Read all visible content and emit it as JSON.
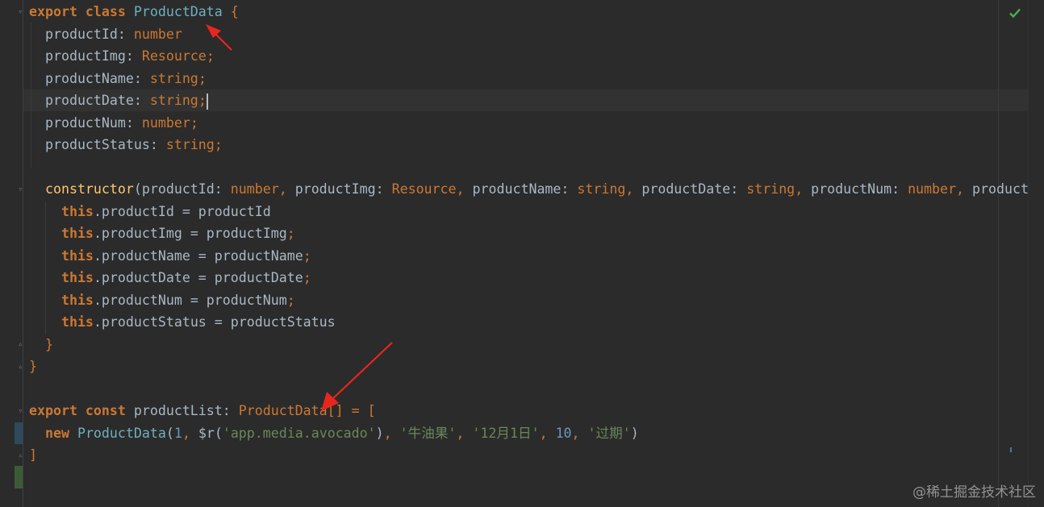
{
  "editor": {
    "code_lines": [
      {
        "tokens": [
          {
            "c": "kw",
            "t": "export class "
          },
          {
            "c": "cls",
            "t": "ProductData"
          },
          {
            "c": "fld",
            "t": " "
          },
          {
            "c": "punc",
            "t": "{"
          }
        ]
      },
      {
        "tokens": [
          {
            "c": "fld",
            "t": "  productId: "
          },
          {
            "c": "type",
            "t": "number"
          }
        ]
      },
      {
        "tokens": [
          {
            "c": "fld",
            "t": "  productImg: "
          },
          {
            "c": "type",
            "t": "Resource"
          },
          {
            "c": "punc",
            "t": ";"
          }
        ]
      },
      {
        "tokens": [
          {
            "c": "fld",
            "t": "  productName: "
          },
          {
            "c": "type",
            "t": "string"
          },
          {
            "c": "punc",
            "t": ";"
          }
        ]
      },
      {
        "tokens": [
          {
            "c": "fld",
            "t": "  productDate: "
          },
          {
            "c": "type",
            "t": "string"
          },
          {
            "c": "punc",
            "t": ";"
          }
        ],
        "cursor": true
      },
      {
        "tokens": [
          {
            "c": "fld",
            "t": "  productNum: "
          },
          {
            "c": "type",
            "t": "number"
          },
          {
            "c": "punc",
            "t": ";"
          }
        ]
      },
      {
        "tokens": [
          {
            "c": "fld",
            "t": "  productStatus: "
          },
          {
            "c": "type",
            "t": "string"
          },
          {
            "c": "punc",
            "t": ";"
          }
        ]
      },
      {
        "tokens": []
      },
      {
        "tokens": [
          {
            "c": "fn",
            "t": "  constructor"
          },
          {
            "c": "fld",
            "t": "(productId: "
          },
          {
            "c": "type",
            "t": "number"
          },
          {
            "c": "punc",
            "t": ","
          },
          {
            "c": "fld",
            "t": " productImg: "
          },
          {
            "c": "type",
            "t": "Resource"
          },
          {
            "c": "punc",
            "t": ","
          },
          {
            "c": "fld",
            "t": " productName: "
          },
          {
            "c": "type",
            "t": "string"
          },
          {
            "c": "punc",
            "t": ","
          },
          {
            "c": "fld",
            "t": " productDate: "
          },
          {
            "c": "type",
            "t": "string"
          },
          {
            "c": "punc",
            "t": ","
          },
          {
            "c": "fld",
            "t": " productNum: "
          },
          {
            "c": "type",
            "t": "number"
          },
          {
            "c": "punc",
            "t": ","
          },
          {
            "c": "fld",
            "t": " product"
          }
        ]
      },
      {
        "tokens": [
          {
            "c": "this-kw",
            "t": "    this"
          },
          {
            "c": "fld",
            "t": ".productId = productId"
          }
        ]
      },
      {
        "tokens": [
          {
            "c": "this-kw",
            "t": "    this"
          },
          {
            "c": "fld",
            "t": ".productImg = productImg"
          },
          {
            "c": "punc",
            "t": ";"
          }
        ]
      },
      {
        "tokens": [
          {
            "c": "this-kw",
            "t": "    this"
          },
          {
            "c": "fld",
            "t": ".productName = productName"
          },
          {
            "c": "punc",
            "t": ";"
          }
        ]
      },
      {
        "tokens": [
          {
            "c": "this-kw",
            "t": "    this"
          },
          {
            "c": "fld",
            "t": ".productDate = productDate"
          },
          {
            "c": "punc",
            "t": ";"
          }
        ]
      },
      {
        "tokens": [
          {
            "c": "this-kw",
            "t": "    this"
          },
          {
            "c": "fld",
            "t": ".productNum = productNum"
          },
          {
            "c": "punc",
            "t": ";"
          }
        ]
      },
      {
        "tokens": [
          {
            "c": "this-kw",
            "t": "    this"
          },
          {
            "c": "fld",
            "t": ".productStatus = productStatus"
          }
        ]
      },
      {
        "tokens": [
          {
            "c": "punc",
            "t": "  }"
          }
        ]
      },
      {
        "tokens": [
          {
            "c": "punc",
            "t": "}"
          }
        ]
      },
      {
        "tokens": []
      },
      {
        "tokens": [
          {
            "c": "kw",
            "t": "export const "
          },
          {
            "c": "fld",
            "t": "productList: "
          },
          {
            "c": "type",
            "t": "ProductData"
          },
          {
            "c": "punc",
            "t": "[] = ["
          }
        ]
      },
      {
        "tokens": [
          {
            "c": "kw",
            "t": "  new "
          },
          {
            "c": "cls",
            "t": "ProductData"
          },
          {
            "c": "fld",
            "t": "("
          },
          {
            "c": "num",
            "t": "1"
          },
          {
            "c": "punc",
            "t": ","
          },
          {
            "c": "fld",
            "t": " $r("
          },
          {
            "c": "str",
            "t": "'app.media.avocado'"
          },
          {
            "c": "fld",
            "t": ")"
          },
          {
            "c": "punc",
            "t": ","
          },
          {
            "c": "fld",
            "t": " "
          },
          {
            "c": "str",
            "t": "'牛油果'"
          },
          {
            "c": "punc",
            "t": ","
          },
          {
            "c": "fld",
            "t": " "
          },
          {
            "c": "str",
            "t": "'12月1日'"
          },
          {
            "c": "punc",
            "t": ","
          },
          {
            "c": "fld",
            "t": " "
          },
          {
            "c": "num",
            "t": "10"
          },
          {
            "c": "punc",
            "t": ","
          },
          {
            "c": "fld",
            "t": " "
          },
          {
            "c": "str",
            "t": "'过期'"
          },
          {
            "c": "fld",
            "t": ")"
          }
        ]
      },
      {
        "tokens": [
          {
            "c": "punc",
            "t": "]"
          }
        ]
      }
    ],
    "status_icon": "check-icon",
    "colors": {
      "background": "#2b2b2b",
      "keyword": "#cc7832",
      "class_name": "#6fafbd",
      "string": "#6a8759",
      "number": "#6897bb",
      "identifier": "#a9b7c6",
      "function": "#ffc66d",
      "annotation_arrow": "#e8261f"
    }
  },
  "watermark": "@稀土掘金技术社区"
}
